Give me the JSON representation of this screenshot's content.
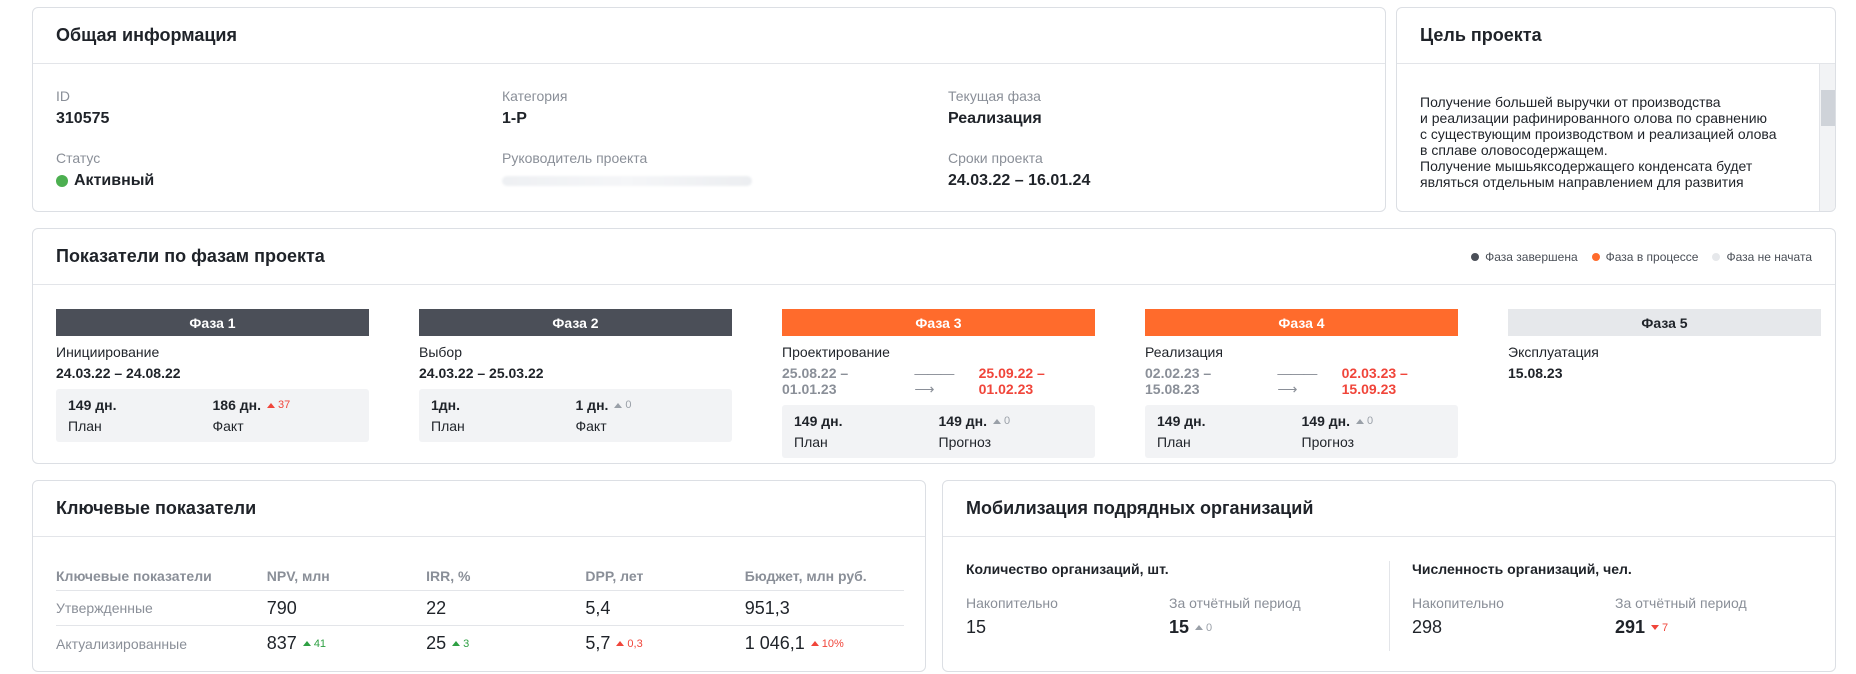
{
  "general": {
    "title": "Общая информация",
    "fields": {
      "id": {
        "label": "ID",
        "value": "310575"
      },
      "category": {
        "label": "Категория",
        "value": "1-Р"
      },
      "phase": {
        "label": "Текущая фаза",
        "value": "Реализация"
      },
      "status": {
        "label": "Статус",
        "value": "Активный"
      },
      "manager": {
        "label": "Руководитель проекта"
      },
      "terms": {
        "label": "Сроки проекта",
        "value": "24.03.22 – 16.01.24"
      }
    }
  },
  "goal": {
    "title": "Цель проекта",
    "text": "Получение большей выручки от производства\nи реализации рафинированного олова по сравнению\nс существующим производством и реализацией олова\nв сплаве оловосодержащем.\nПолучение мышьяксодержащего конденсата будет\nявляться отдельным направлением для развития\nпродукции ПОКМ"
  },
  "phases": {
    "title": "Показатели по фазам проекта",
    "legend": [
      {
        "label": "Фаза завершена",
        "color": "#4b4f58"
      },
      {
        "label": "Фаза в процессе",
        "color": "#ff6b2c"
      },
      {
        "label": "Фаза не начата",
        "color": "#e6e8eb"
      }
    ],
    "items": [
      {
        "bar": "Фаза 1",
        "name": "Инициирование",
        "dates": "24.03.22 – 24.08.22",
        "plan_value": "149 дн.",
        "plan_label": "План",
        "second_value": "186 дн.",
        "second_label": "Факт",
        "delta": "37"
      },
      {
        "bar": "Фаза 2",
        "name": "Выбор",
        "dates": "24.03.22 – 25.03.22",
        "plan_value": "1дн.",
        "plan_label": "План",
        "second_value": "1 дн.",
        "second_label": "Факт",
        "delta": "0"
      },
      {
        "bar": "Фаза 3",
        "name": "Проектирование",
        "dates_plan": "25.08.22 – 01.01.23",
        "dates_fact": "25.09.22 – 01.02.23",
        "plan_value": "149 дн.",
        "plan_label": "План",
        "second_value": "149 дн.",
        "second_label": "Прогноз",
        "delta": "0"
      },
      {
        "bar": "Фаза 4",
        "name": "Реализация",
        "dates_plan": "02.02.23 – 15.08.23",
        "dates_fact": "02.03.23 – 15.09.23",
        "plan_value": "149 дн.",
        "plan_label": "План",
        "second_value": "149 дн.",
        "second_label": "Прогноз",
        "delta": "0"
      },
      {
        "bar": "Фаза 5",
        "name": "Эксплуатация",
        "dates": "15.08.23"
      }
    ]
  },
  "kpi": {
    "title": "Ключевые показатели",
    "headers": [
      "Ключевые показатели",
      "NPV, млн",
      "IRR, %",
      "DPP, лет",
      "Бюджет, млн руб."
    ],
    "approved": {
      "label": "Утвержденные",
      "values": [
        "790",
        "22",
        "5,4",
        "951,3"
      ]
    },
    "actual": {
      "label": "Актуализированные",
      "values": [
        "837",
        "25",
        "5,7",
        "1 046,1"
      ],
      "deltas": [
        "41",
        "3",
        "0,3",
        "10%"
      ]
    }
  },
  "mobilization": {
    "title": "Мобилизация подрядных организаций",
    "count": {
      "title": "Количество организаций, шт.",
      "cumulative_label": "Накопительно",
      "cumulative_value": "15",
      "period_label": "За отчётный период",
      "period_value": "15",
      "period_delta": "0"
    },
    "headcount": {
      "title": "Численность организаций, чел.",
      "cumulative_label": "Накопительно",
      "cumulative_value": "298",
      "period_label": "За отчётный период",
      "period_value": "291",
      "period_delta": "7"
    }
  }
}
